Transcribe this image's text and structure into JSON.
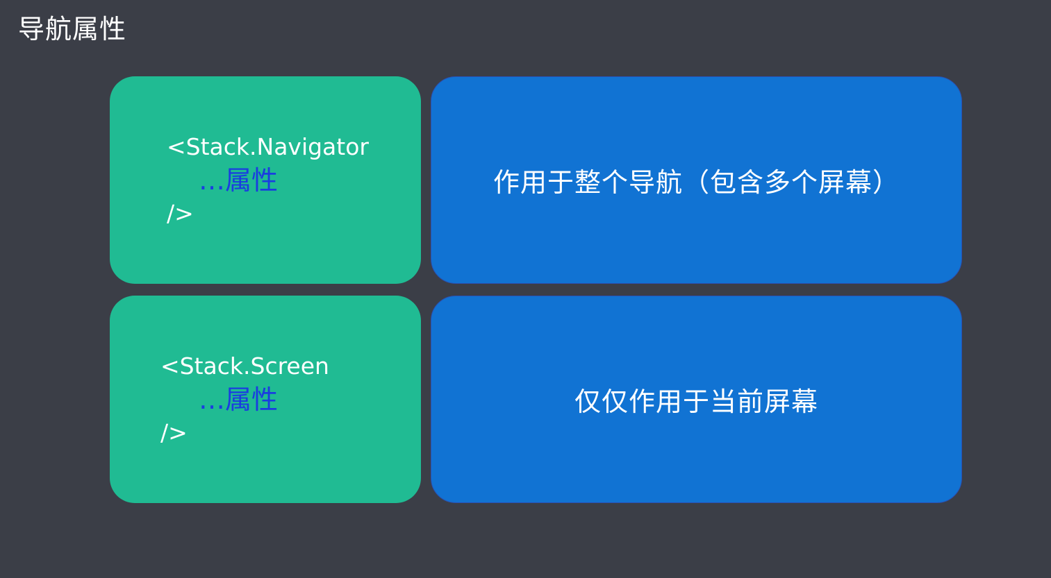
{
  "title": "导航属性",
  "rows": [
    {
      "code_open": "<Stack.Navigator",
      "code_attr": "…属性",
      "code_close": "/>",
      "description": "作用于整个导航（包含多个屏幕）"
    },
    {
      "code_open": "<Stack.Screen",
      "code_attr": "…属性",
      "code_close": "/>",
      "description": "仅仅作用于当前屏幕"
    }
  ],
  "colors": {
    "background": "#3b3e47",
    "code_card": "#20bb93",
    "description_card": "#1173d3",
    "attr_text": "#1a3de0"
  }
}
